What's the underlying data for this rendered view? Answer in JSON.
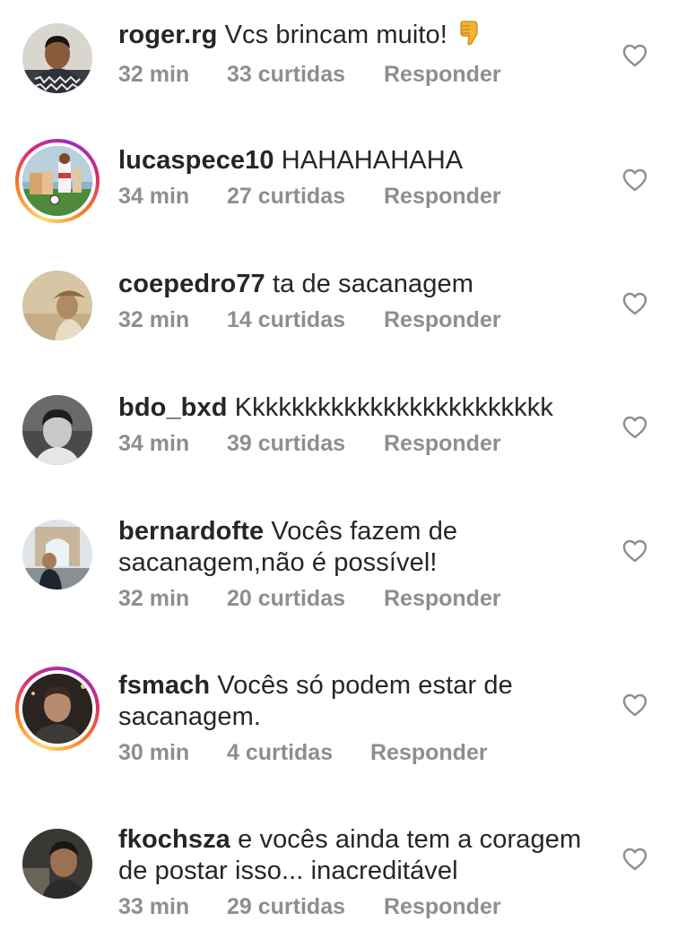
{
  "comments": [
    {
      "username": "roger.rg",
      "text": "Vcs brincam muito!",
      "emoji": "thumbs-down",
      "time": "32 min",
      "likes": "33 curtidas",
      "reply": "Responder"
    },
    {
      "username": "lucaspece10",
      "text": "HAHAHAHAHA",
      "time": "34 min",
      "likes": "27 curtidas",
      "reply": "Responder"
    },
    {
      "username": "coepedro77",
      "text": "ta de sacanagem",
      "time": "32 min",
      "likes": "14 curtidas",
      "reply": "Responder"
    },
    {
      "username": "bdo_bxd",
      "text": "Kkkkkkkkkkkkkkkkkkkkkkkk",
      "time": "34 min",
      "likes": "39 curtidas",
      "reply": "Responder"
    },
    {
      "username": "bernardofte",
      "text": "Vocês fazem de",
      "text2": "sacanagem,não é possível!",
      "time": "32 min",
      "likes": "20 curtidas",
      "reply": "Responder"
    },
    {
      "username": "fsmach",
      "text": "Vocês só podem estar de",
      "text2": "sacanagem.",
      "time": "30 min",
      "likes": "4 curtidas",
      "reply": "Responder"
    },
    {
      "username": "fkochsza",
      "text": "e vocês ainda tem a coragem",
      "text2": "de postar isso... inacreditável",
      "time": "33 min",
      "likes": "29 curtidas",
      "reply": "Responder"
    }
  ],
  "colors": {
    "text": "#262626",
    "meta": "#8e8e8e",
    "heart": "#8e8e8e"
  },
  "icons": {
    "like": "heart-outline-icon",
    "emoji": "thumbs-down-emoji"
  }
}
